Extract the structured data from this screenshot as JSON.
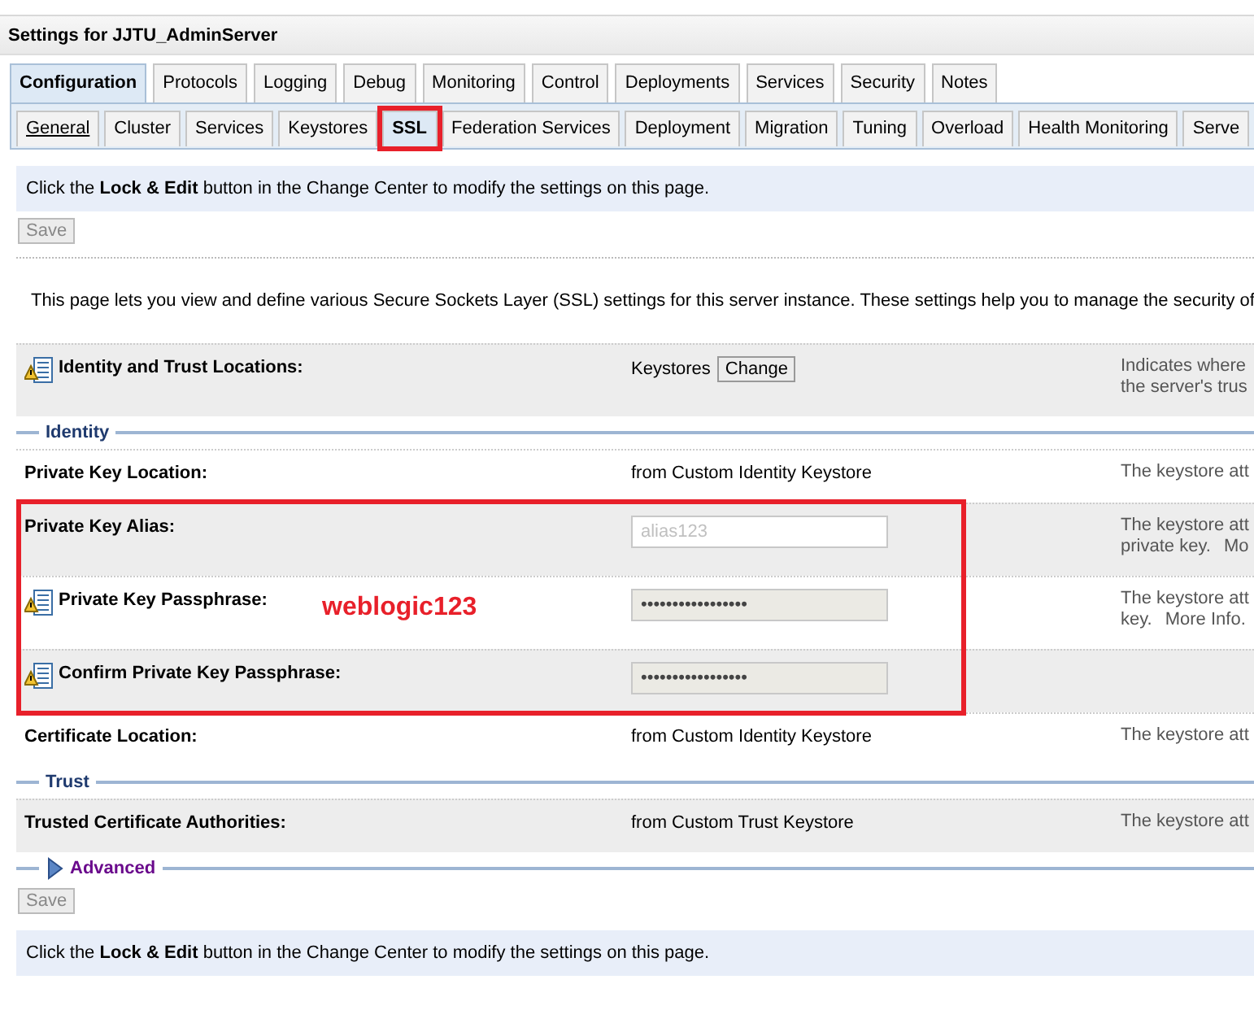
{
  "header": {
    "title": "Settings for JJTU_AdminServer"
  },
  "tabs": [
    {
      "label": "Configuration",
      "selected": true
    },
    {
      "label": "Protocols",
      "selected": false
    },
    {
      "label": "Logging",
      "selected": false
    },
    {
      "label": "Debug",
      "selected": false
    },
    {
      "label": "Monitoring",
      "selected": false
    },
    {
      "label": "Control",
      "selected": false
    },
    {
      "label": "Deployments",
      "selected": false
    },
    {
      "label": "Services",
      "selected": false
    },
    {
      "label": "Security",
      "selected": false
    },
    {
      "label": "Notes",
      "selected": false
    }
  ],
  "subtabs": [
    {
      "label": "General",
      "selected": false,
      "underlined": true,
      "annotated": false
    },
    {
      "label": "Cluster",
      "selected": false,
      "underlined": false,
      "annotated": false
    },
    {
      "label": "Services",
      "selected": false,
      "underlined": false,
      "annotated": false
    },
    {
      "label": "Keystores",
      "selected": false,
      "underlined": false,
      "annotated": false
    },
    {
      "label": "SSL",
      "selected": true,
      "underlined": false,
      "annotated": true
    },
    {
      "label": "Federation Services",
      "selected": false,
      "underlined": false,
      "annotated": false
    },
    {
      "label": "Deployment",
      "selected": false,
      "underlined": false,
      "annotated": false
    },
    {
      "label": "Migration",
      "selected": false,
      "underlined": false,
      "annotated": false
    },
    {
      "label": "Tuning",
      "selected": false,
      "underlined": false,
      "annotated": false
    },
    {
      "label": "Overload",
      "selected": false,
      "underlined": false,
      "annotated": false
    },
    {
      "label": "Health Monitoring",
      "selected": false,
      "underlined": false,
      "annotated": false
    },
    {
      "label": "Serve",
      "selected": false,
      "underlined": false,
      "annotated": false
    }
  ],
  "notice_top": "Click the **Lock & Edit** button in the Change Center to modify the settings on this page.",
  "save_top": {
    "label": "Save",
    "disabled": true
  },
  "intro": "This page lets you view and define various Secure Sockets Layer (SSL) settings for this server instance. These settings help you to manage the security of",
  "rows": [
    {
      "kind": "setting",
      "label": "Identity and Trust Locations:",
      "has_icon": true,
      "shaded": true,
      "annotated": false,
      "control": {
        "kind": "text_button",
        "text": "Keystores",
        "button": "Change"
      },
      "description": [
        {
          "text": "Indicates where"
        },
        {
          "text": "the server's trus"
        }
      ]
    },
    {
      "kind": "legend",
      "label": "Identity"
    },
    {
      "kind": "setting",
      "label": "Private Key Location:",
      "has_icon": false,
      "shaded": false,
      "annotated": false,
      "control": {
        "kind": "text",
        "text": "from Custom Identity Keystore"
      },
      "description": [
        {
          "text": "The keystore att"
        }
      ]
    },
    {
      "kind": "setting",
      "label": "Private Key Alias:",
      "has_icon": false,
      "shaded": true,
      "annotated": true,
      "control": {
        "kind": "field",
        "value": "alias123",
        "disabled": true
      },
      "description": [
        {
          "text": "The keystore att"
        },
        {
          "text": "private key.",
          "link": "Mo"
        }
      ]
    },
    {
      "kind": "setting",
      "label": "Private Key Passphrase:",
      "has_icon": true,
      "shaded": false,
      "annotated": true,
      "note": "weblogic123",
      "control": {
        "kind": "password",
        "value": "•••••••••••••••••"
      },
      "description": [
        {
          "text": "The keystore att"
        },
        {
          "text": "key.",
          "link": "More Info."
        }
      ]
    },
    {
      "kind": "setting",
      "label": "Confirm Private Key Passphrase:",
      "has_icon": true,
      "shaded": true,
      "annotated": true,
      "control": {
        "kind": "password",
        "value": "•••••••••••••••••"
      }
    },
    {
      "kind": "setting",
      "label": "Certificate Location:",
      "has_icon": false,
      "shaded": false,
      "annotated": false,
      "control": {
        "kind": "text",
        "text": "from Custom Identity Keystore"
      },
      "description": [
        {
          "text": "The keystore att"
        }
      ]
    },
    {
      "kind": "legend",
      "label": "Trust"
    },
    {
      "kind": "setting",
      "label": "Trusted Certificate Authorities:",
      "has_icon": false,
      "shaded": true,
      "annotated": false,
      "control": {
        "kind": "text",
        "text": "from Custom Trust Keystore"
      },
      "description": [
        {
          "text": "The keystore att"
        }
      ]
    },
    {
      "kind": "expander",
      "label": "Advanced",
      "expanded": false
    }
  ],
  "save_bottom": {
    "label": "Save",
    "disabled": true
  },
  "notice_bottom": "Click the **Lock & Edit** button in the Change Center to modify the settings on this page."
}
